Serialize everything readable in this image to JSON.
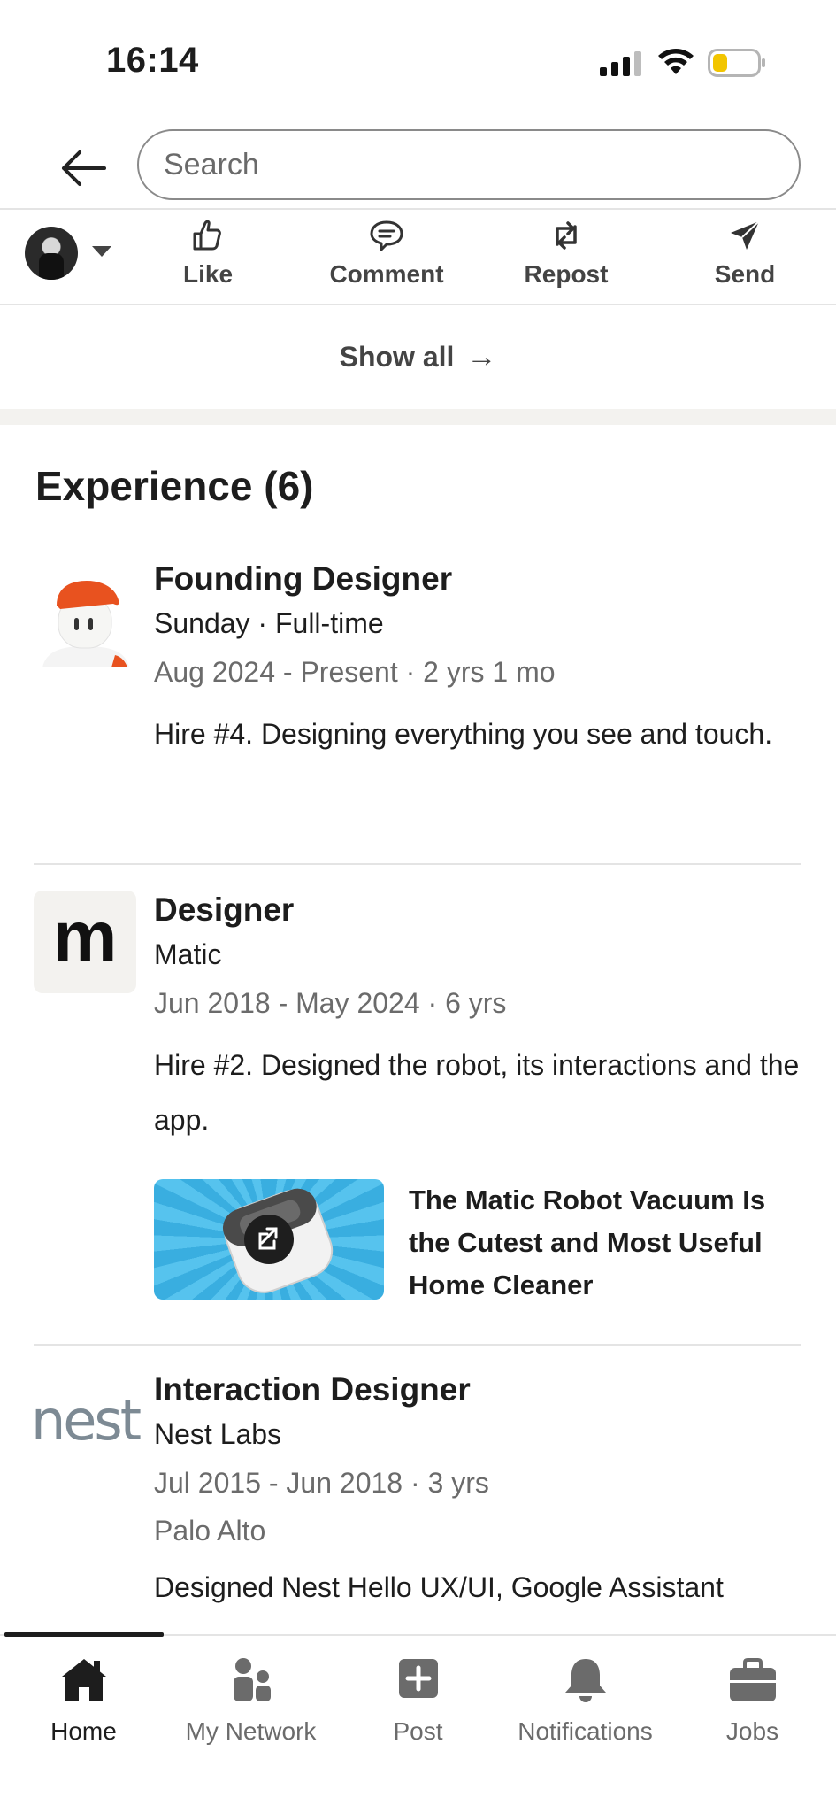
{
  "status_bar": {
    "time": "16:14"
  },
  "search": {
    "placeholder": "Search"
  },
  "actions": [
    {
      "label": "Like",
      "icon": "like-icon"
    },
    {
      "label": "Comment",
      "icon": "comment-icon"
    },
    {
      "label": "Repost",
      "icon": "repost-icon"
    },
    {
      "label": "Send",
      "icon": "send-icon"
    }
  ],
  "show_all": {
    "label": "Show all",
    "arrow": "→"
  },
  "experience": {
    "title": "Experience (6)",
    "items": [
      {
        "role": "Founding Designer",
        "company": "Sunday · Full-time",
        "dates": "Aug 2024 - Present · 2 yrs 1 mo",
        "description": "Hire #4. Designing everything you see and touch."
      },
      {
        "role": "Designer",
        "company": "Matic",
        "dates": "Jun 2018 - May 2024 · 6 yrs",
        "description": "Hire #2. Designed the robot, its interactions and the app.",
        "logo_letter": "m",
        "media": {
          "title": "The Matic Robot Vacuum Is the Cutest and Most Useful Home Cleaner"
        }
      },
      {
        "role": "Interaction Designer",
        "company": "Nest Labs",
        "dates": "Jul 2015 - Jun 2018 · 3 yrs",
        "location": "Palo Alto",
        "description": "Designed Nest Hello UX/UI, Google Assistant",
        "logo_text": "nest"
      }
    ]
  },
  "bottom_nav": [
    {
      "label": "Home",
      "icon": "home-icon",
      "active": true
    },
    {
      "label": "My Network",
      "icon": "network-icon"
    },
    {
      "label": "Post",
      "icon": "post-icon"
    },
    {
      "label": "Notifications",
      "icon": "bell-icon"
    },
    {
      "label": "Jobs",
      "icon": "briefcase-icon"
    }
  ],
  "colors": {
    "text_primary": "#1d1d1d",
    "text_secondary": "#6b6b6b",
    "section_gap": "#f3f2ef",
    "matic_card_bg": "#39aee0",
    "nest_logo": "#7d8a94",
    "sunday_cap": "#e8521f"
  }
}
